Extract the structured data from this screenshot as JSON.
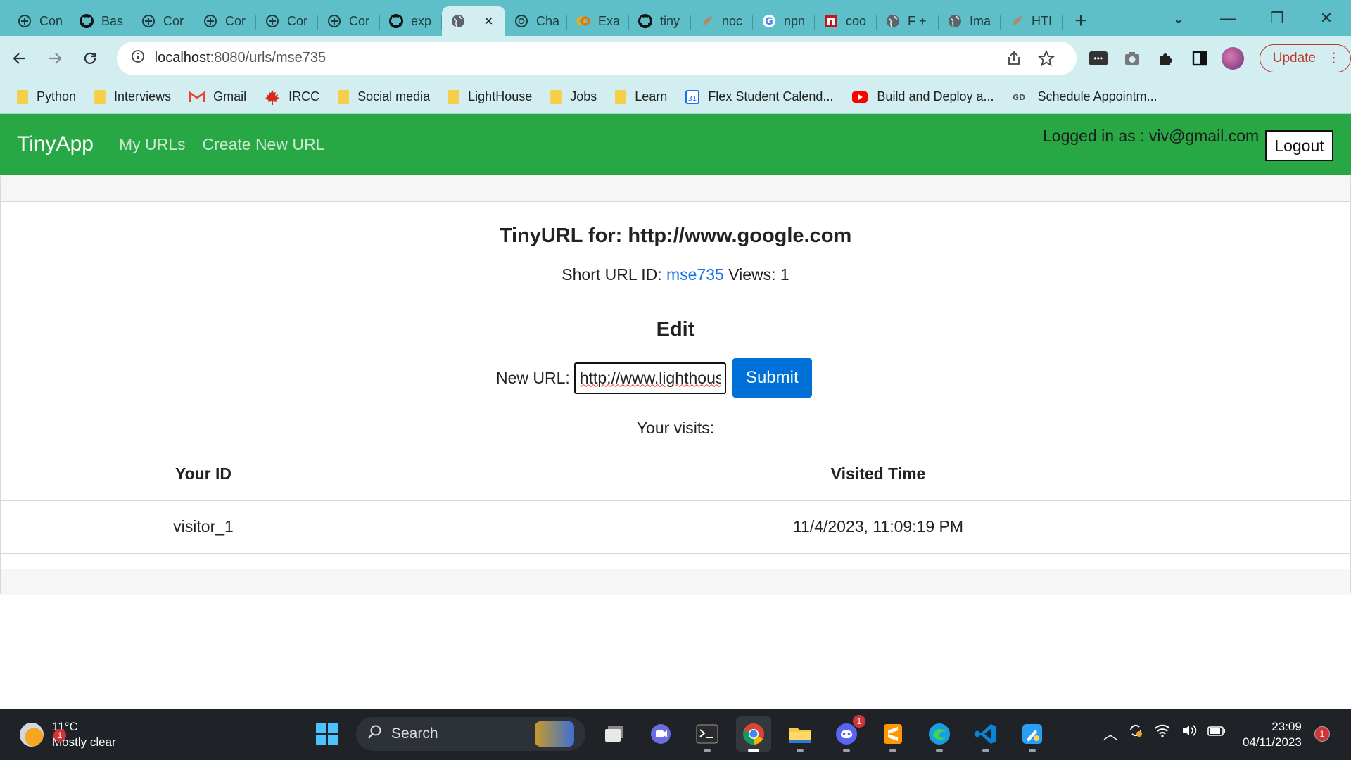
{
  "browser": {
    "tabs": [
      {
        "label": "Con",
        "icon": "add-circle-icon"
      },
      {
        "label": "Bas",
        "icon": "github-icon"
      },
      {
        "label": "Cor",
        "icon": "add-circle-icon"
      },
      {
        "label": "Cor",
        "icon": "add-circle-icon"
      },
      {
        "label": "Cor",
        "icon": "add-circle-icon"
      },
      {
        "label": "Cor",
        "icon": "add-circle-icon"
      },
      {
        "label": "exp",
        "icon": "github-icon"
      },
      {
        "label": "",
        "icon": "globe-icon",
        "active": true
      },
      {
        "label": "Cha",
        "icon": "openai-icon"
      },
      {
        "label": "Exa",
        "icon": "colab-icon"
      },
      {
        "label": "tiny",
        "icon": "github-icon"
      },
      {
        "label": "noc",
        "icon": "feather-icon"
      },
      {
        "label": "npn",
        "icon": "google-icon"
      },
      {
        "label": "coo",
        "icon": "red-n-icon"
      },
      {
        "label": "F +",
        "icon": "globe-icon"
      },
      {
        "label": "Ima",
        "icon": "globe-icon"
      },
      {
        "label": "HTI",
        "icon": "feather-icon"
      }
    ],
    "active_tab_close": "×",
    "new_tab": "+",
    "address": {
      "host": "localhost",
      "path": ":8080/urls/mse735"
    },
    "update_label": "Update",
    "bookmarks": [
      {
        "label": "Python",
        "icon": "folder-icon"
      },
      {
        "label": "Interviews",
        "icon": "folder-icon"
      },
      {
        "label": "Gmail",
        "icon": "gmail-icon"
      },
      {
        "label": "IRCC",
        "icon": "maple-leaf-icon"
      },
      {
        "label": "Social media",
        "icon": "folder-icon"
      },
      {
        "label": "LightHouse",
        "icon": "folder-icon"
      },
      {
        "label": "Jobs",
        "icon": "folder-icon"
      },
      {
        "label": "Learn",
        "icon": "folder-icon"
      },
      {
        "label": "Flex Student Calend...",
        "icon": "calendar-icon"
      },
      {
        "label": "Build and Deploy a...",
        "icon": "youtube-icon"
      },
      {
        "label": "Schedule Appointm...",
        "icon": "gd-icon"
      }
    ]
  },
  "navbar": {
    "brand": "TinyApp",
    "links": [
      "My URLs",
      "Create New URL"
    ],
    "logged_in": "Logged in as : viv@gmail.com",
    "logout": "Logout"
  },
  "main": {
    "title": "TinyURL for: http://www.google.com",
    "short_label": "Short URL ID:",
    "short_id": "mse735",
    "views_label": "Views:",
    "views": "1",
    "edit_heading": "Edit",
    "new_url_label": "New URL:",
    "new_url_value": "http://www.lighthouselabs",
    "submit_label": "Submit",
    "visits_label": "Your visits:",
    "table": {
      "headers": [
        "Your ID",
        "Visited Time"
      ],
      "rows": [
        [
          "visitor_1",
          "11/4/2023, 11:09:19 PM"
        ]
      ]
    }
  },
  "taskbar": {
    "weather_temp": "11°C",
    "weather_desc": "Mostly clear",
    "weather_badge": "1",
    "search_label": "Search",
    "discord_badge": "1",
    "time": "23:09",
    "date": "04/11/2023",
    "notification_count": "1"
  }
}
